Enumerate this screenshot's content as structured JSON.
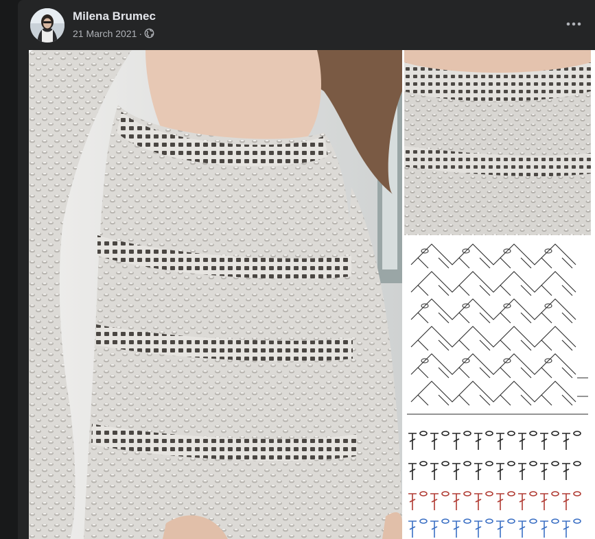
{
  "post": {
    "author_name": "Milena Brumec",
    "date": "21 March 2021",
    "separator": "·",
    "privacy_icon": "globe-icon",
    "more_icon": "more-options-icon"
  },
  "media": {
    "photos": [
      {
        "subject": "crochet-sweater-full"
      },
      {
        "subject": "crochet-sweater-closeup"
      },
      {
        "subject": "crochet-stitch-chart"
      },
      {
        "subject": "crochet-row-chart"
      }
    ]
  },
  "colors": {
    "page_bg": "#18191a",
    "card_bg": "#242526",
    "primary_text": "#e4e6eb",
    "secondary_text": "#b0b3b8",
    "chart_black": "#222222",
    "chart_red": "#b03a32",
    "chart_blue": "#3a6fc4"
  }
}
